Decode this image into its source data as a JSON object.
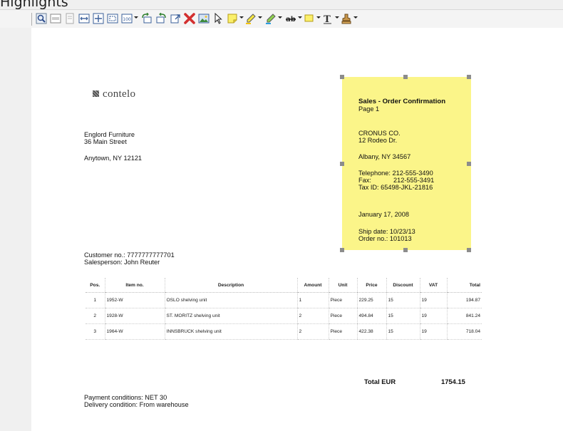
{
  "window": {
    "partial_title": "Highlights"
  },
  "toolbar": {
    "icons": [
      "zoom-icon",
      "ocr-icon",
      "page-icon",
      "fit-width-icon",
      "fit-page-icon",
      "zoom-box-icon",
      "zoom-100-icon",
      "rotate-left-icon",
      "rotate-right-icon",
      "export-icon",
      "delete-icon",
      "image-icon",
      "pointer-icon",
      "note-icon",
      "highlight-icon",
      "marker-icon",
      "strikethrough-icon",
      "rectangle-icon",
      "text-icon",
      "stamp-icon"
    ]
  },
  "document": {
    "logo_text": "contelo",
    "customer_address": [
      "Englord Furniture",
      "36 Main Street",
      "",
      "Anytown, NY 12121"
    ],
    "confirmation": {
      "title": "Sales - Order Confirmation",
      "page": "Page 1",
      "company": [
        "CRONUS CO.",
        "12 Rodeo Dr.",
        "",
        "Albany, NY 34567"
      ],
      "telephone": "Telephone: 212-555-3490",
      "fax_label": "Fax:",
      "fax_value": "212-555-3491",
      "tax_id": "Tax ID: 65498-JKL-21816",
      "date": "January 17, 2008",
      "ship_date": "Ship date: 10/23/13",
      "order_no": "Order no.: 101013"
    },
    "customer_no": "Customer no.: 7777777777701",
    "salesperson": "Salesperson:  John Reuter",
    "table": {
      "headers": [
        "Pos.",
        "Item no.",
        "Description",
        "Amount",
        "Unit",
        "Price",
        "Discount",
        "VAT",
        "Total"
      ],
      "rows": [
        [
          "1",
          "1952-W",
          "OSLO shelving unit",
          "1",
          "Piece",
          "229.25",
          "15",
          "19",
          "194.87"
        ],
        [
          "2",
          "1928-W",
          "ST. MORITZ shelving unit",
          "2",
          "Piece",
          "494.84",
          "15",
          "19",
          "841.24"
        ],
        [
          "3",
          "1964-W",
          "INNSBRUCK shelving unit",
          "2",
          "Piece",
          "422.38",
          "15",
          "19",
          "718.04"
        ]
      ]
    },
    "total_label": "Total EUR",
    "total_value": "1754.15",
    "payment_conditions": "Payment conditions: NET 30",
    "delivery_condition": "Delivery condition: From warehouse"
  },
  "colors": {
    "note_yellow": "#fbf589",
    "handle_gray": "#8c8c8c",
    "delete_red": "#d32f2f"
  }
}
